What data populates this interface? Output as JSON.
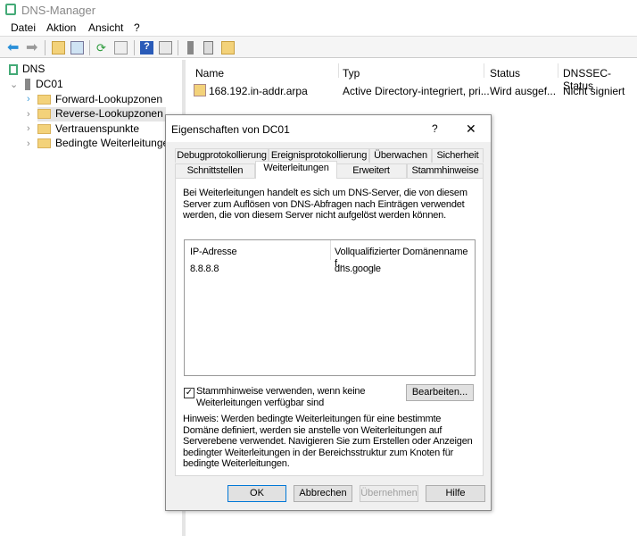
{
  "window": {
    "title": "DNS-Manager"
  },
  "menu": [
    "Datei",
    "Aktion",
    "Ansicht",
    "?"
  ],
  "toolbar": [
    "back-icon",
    "forward-icon",
    "up-folder-icon",
    "show-hide-tree-icon",
    "refresh-icon",
    "export-icon",
    "help-icon",
    "properties-icon",
    "server-icon",
    "list-icon",
    "zone-icon"
  ],
  "tree": {
    "root": "DNS",
    "server": "DC01",
    "children": [
      "Forward-Lookupzonen",
      "Reverse-Lookupzonen",
      "Vertrauenspunkte",
      "Bedingte Weiterleitungen"
    ]
  },
  "list": {
    "columns": [
      "Name",
      "Typ",
      "Status",
      "DNSSEC-Status"
    ],
    "rows": [
      {
        "name": "168.192.in-addr.arpa",
        "type": "Active Directory-integriert, pri...",
        "status": "Wird ausgef...",
        "dnssec": "Nicht signiert"
      }
    ]
  },
  "dialog": {
    "title": "Eigenschaften von DC01",
    "help": "?",
    "close": "✕",
    "tabs_row1": [
      "Debugprotokollierung",
      "Ereignisprotokollierung",
      "Überwachen",
      "Sicherheit"
    ],
    "tabs_row2": [
      "Schnittstellen",
      "Weiterleitungen",
      "Erweitert",
      "Stammhinweise"
    ],
    "description": "Bei Weiterleitungen handelt es sich um DNS-Server, die von diesem Server zum Auflösen von DNS-Abfragen nach Einträgen verwendet werden, die von diesem Server nicht aufgelöst werden können.",
    "forwarders": {
      "columns": [
        "IP-Adresse",
        "Vollqualifizierter Domänenname f..."
      ],
      "rows": [
        {
          "ip": "8.8.8.8",
          "fqdn": "dns.google"
        }
      ]
    },
    "use_root_hints_label": "Stammhinweise verwenden, wenn keine Weiterleitungen verfügbar sind",
    "use_root_hints_checked": true,
    "edit_button": "Bearbeiten...",
    "note": "Hinweis: Werden bedingte Weiterleitungen für eine bestimmte Domäne definiert, werden sie anstelle von Weiterleitungen auf Serverebene verwendet. Navigieren Sie zum Erstellen oder Anzeigen bedingter Weiterleitungen in der Bereichsstruktur zum Knoten für bedingte Weiterleitungen.",
    "buttons": {
      "ok": "OK",
      "cancel": "Abbrechen",
      "apply": "Übernehmen",
      "help": "Hilfe"
    }
  }
}
